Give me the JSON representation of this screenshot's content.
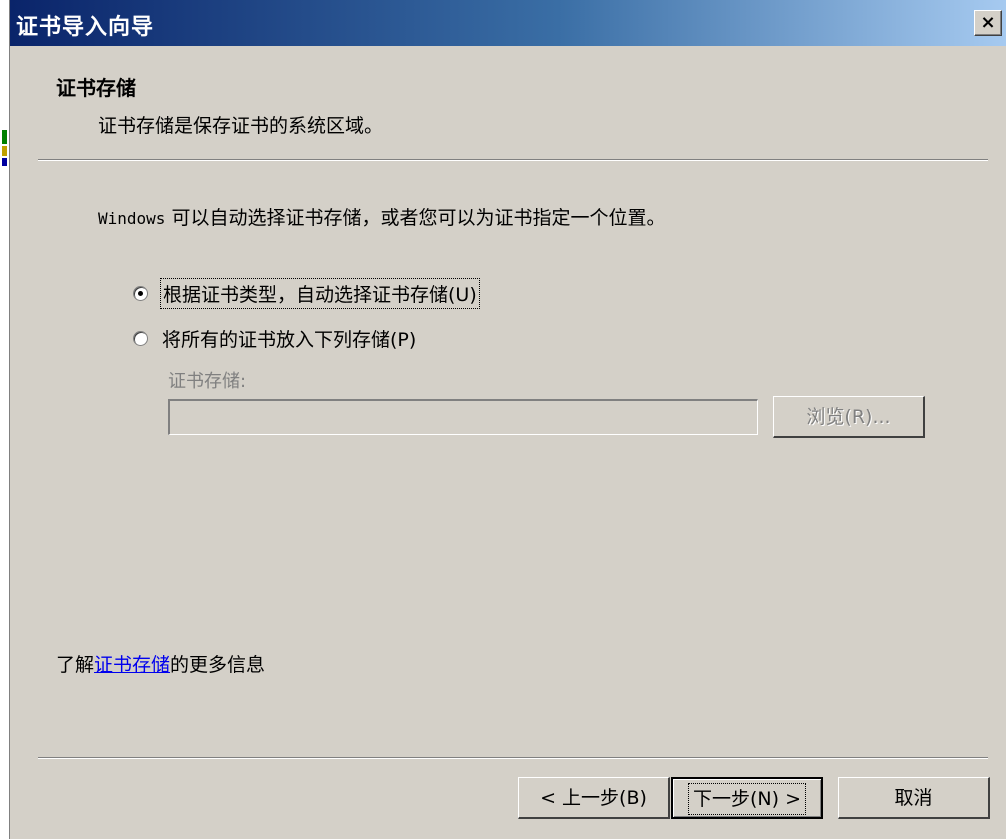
{
  "window": {
    "title": "证书导入向导",
    "close_label": "×"
  },
  "header": {
    "title": "证书存储",
    "description": "证书存储是保存证书的系统区域。"
  },
  "main": {
    "intro_prefix": "Windows",
    "intro_rest": " 可以自动选择证书存储，或者您可以为证书指定一个位置。",
    "options": [
      {
        "label": "根据证书类型，自动选择证书存储(U)",
        "checked": true
      },
      {
        "label": "将所有的证书放入下列存储(P)",
        "checked": false
      }
    ],
    "store_label": "证书存储:",
    "store_value": "",
    "browse_label": "浏览(R)..."
  },
  "footer": {
    "more_info_prefix": "了解",
    "more_info_link": "证书存储",
    "more_info_suffix": "的更多信息",
    "back_label": "< 上一步(B)",
    "next_label": "下一步(N) >",
    "cancel_label": "取消"
  },
  "colors": {
    "dialog_bg": "#d4d0c8",
    "title_gradient_start": "#0a246a",
    "title_gradient_end": "#a6caf0",
    "link": "#0000ee",
    "disabled_text": "#808080"
  }
}
